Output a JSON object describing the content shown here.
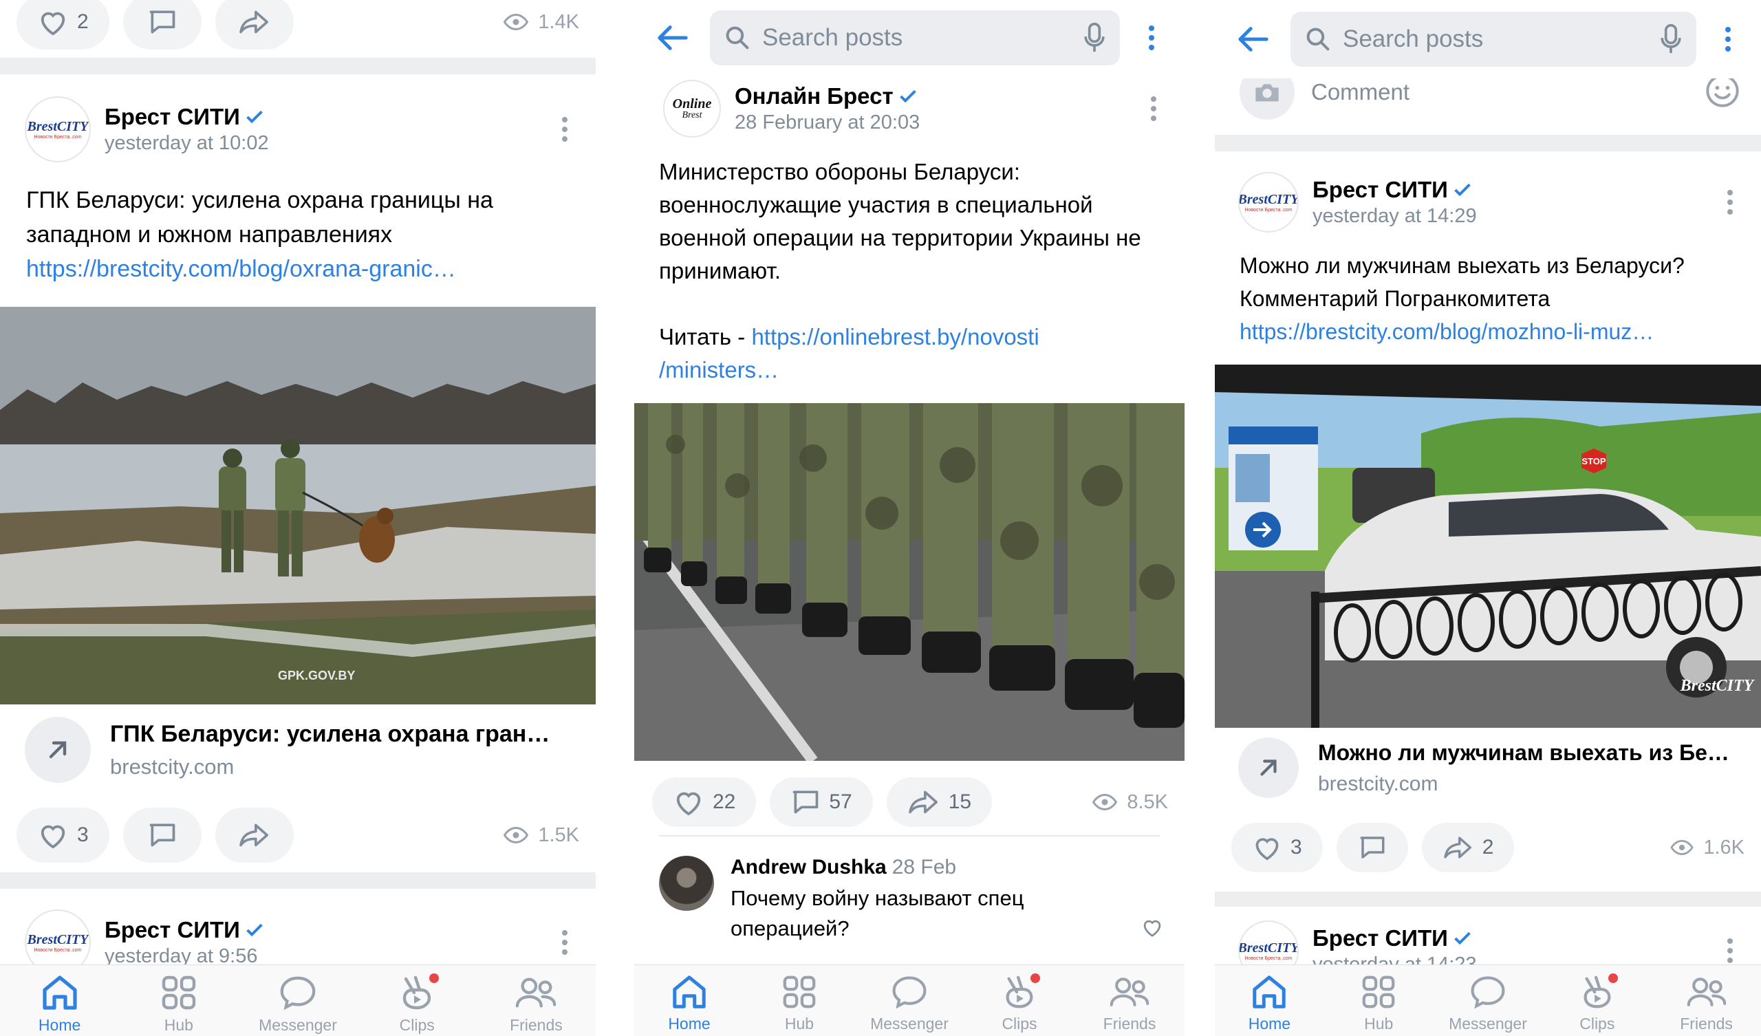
{
  "colors": {
    "accent": "#2d81e0",
    "secondary_text": "#818c99",
    "background": "#edeef0",
    "badge": "#e64646"
  },
  "search": {
    "placeholder": "Search posts"
  },
  "tabs": [
    {
      "label": "Home",
      "icon": "home-icon",
      "active": true
    },
    {
      "label": "Hub",
      "icon": "grid-icon"
    },
    {
      "label": "Messenger",
      "icon": "chat-bubble-icon"
    },
    {
      "label": "Clips",
      "icon": "clips-icon",
      "badge": true
    },
    {
      "label": "Friends",
      "icon": "friends-icon"
    }
  ],
  "panel1": {
    "top_actions": {
      "likes": "2",
      "views": "1.4K"
    },
    "post": {
      "author": "Брест СИТИ",
      "avatar_text": "BrestCITY",
      "avatar_sub": "Новости Бреста .com",
      "date": "yesterday at 10:02",
      "text": "ГПК Беларуси: усилена охрана границы на западном и южном направлениях",
      "link": "https://brestcity.com/blog/oxrana-granic…",
      "image_watermark": "GPK.GOV.BY",
      "snippet_title": "ГПК Беларуси: усилена охрана грани…",
      "snippet_domain": "brestcity.com",
      "likes": "3",
      "views": "1.5K"
    },
    "next_post": {
      "author": "Брест СИТИ",
      "date": "yesterday at 9:56"
    }
  },
  "panel2": {
    "post": {
      "author": "Онлайн Брест",
      "avatar_text": "Online",
      "avatar_sub": "Brest",
      "date": "28 February at 20:03",
      "text": "Министерство обороны Беларуси: военнослужащие участия в специальной военной операции на территории Украины не принимают.",
      "read_label": "Читать - ",
      "link_line1": "https://onlinebrest.by/novosti",
      "link_line2": "/ministers…",
      "likes": "22",
      "comments": "57",
      "shares": "15",
      "views": "8.5K"
    },
    "comment": {
      "author": "Andrew Dushka",
      "date": "28 Feb",
      "text": "Почему войну называют спец операцией?"
    }
  },
  "panel3": {
    "comment_placeholder": "Comment",
    "post": {
      "author": "Брест СИТИ",
      "avatar_text": "BrestCITY",
      "avatar_sub": "Новости Бреста .com",
      "date": "yesterday at 14:29",
      "text": "Можно ли мужчинам выехать из Беларуси? Комментарий Погранкомитета",
      "link": "https://brestcity.com/blog/mozhno-li-muz…",
      "image_sign": "STOP",
      "image_watermark": "BrestCITY",
      "snippet_title": "Можно ли мужчинам выехать из Бел…",
      "snippet_domain": "brestcity.com",
      "likes": "3",
      "shares": "2",
      "views": "1.6K"
    },
    "next_post": {
      "author": "Брест СИТИ",
      "date": "yesterday at 14:23"
    }
  }
}
